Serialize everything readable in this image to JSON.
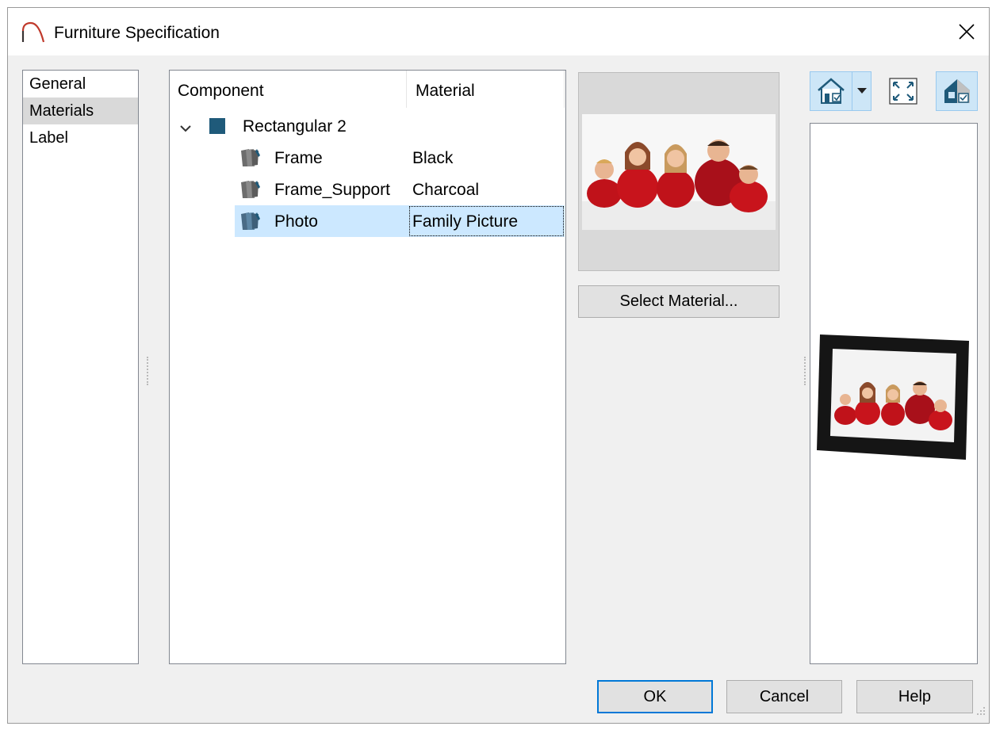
{
  "window": {
    "title": "Furniture Specification"
  },
  "nav": {
    "items": [
      {
        "label": "General"
      },
      {
        "label": "Materials"
      },
      {
        "label": "Label"
      }
    ],
    "selected": "Materials"
  },
  "tree": {
    "columns": {
      "component": "Component",
      "material": "Material"
    },
    "rows": [
      {
        "component": "Rectangular 2",
        "material": "",
        "expanded": true
      },
      {
        "component": "Frame",
        "material": "Black"
      },
      {
        "component": "Frame_Support",
        "material": "Charcoal"
      },
      {
        "component": "Photo",
        "material": "Family Picture",
        "selected": true
      }
    ]
  },
  "preview": {
    "image": "family-picture-thumbnail"
  },
  "buttons": {
    "select_material": "Select Material...",
    "ok": "OK",
    "cancel": "Cancel",
    "help": "Help"
  },
  "toolbar": {
    "icons": [
      "camera-view-icon",
      "dropdown-arrow-icon",
      "fill-window-icon",
      "render-options-icon"
    ]
  },
  "colors": {
    "selection": "#cce8ff",
    "accent": "#0078d7",
    "component_color": "#1f5a7a"
  }
}
